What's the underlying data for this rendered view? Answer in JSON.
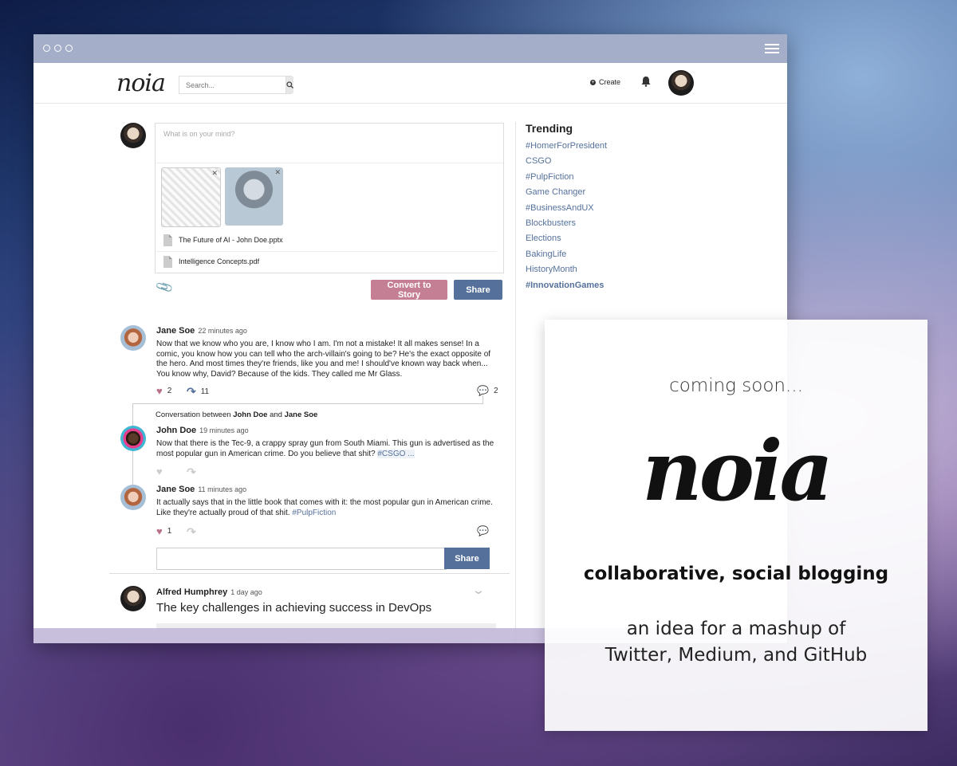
{
  "header": {
    "logo": "noia",
    "search_placeholder": "Search...",
    "create_label": "Create"
  },
  "composer": {
    "placeholder": "What is on your mind?",
    "files": [
      {
        "name": "The Future of AI - John Doe.pptx",
        "type": "PPT"
      },
      {
        "name": "Intelligence Concepts.pdf",
        "type": "PDF"
      }
    ],
    "convert_label": "Convert to Story",
    "share_label": "Share"
  },
  "post1": {
    "author": "Jane Soe",
    "time": "22 minutes ago",
    "text": "Now that we know who you are, I know who I am. I'm not a mistake! It all makes sense! In a comic, you know how you can tell who the arch-villain's going to be? He's the exact opposite of the hero. And most times they're friends, like you and me! I should've known way back when... You know why, David? Because of the kids. They called me Mr Glass.",
    "likes": "2",
    "shares": "11",
    "comments": "2"
  },
  "conversation": {
    "prefix": "Conversation between",
    "person1": "John Doe",
    "and": "and",
    "person2": "Jane Soe"
  },
  "reply1": {
    "author": "John Doe",
    "time": "19 minutes ago",
    "text": "Now that there is the Tec-9, a crappy spray gun from South Miami. This gun is advertised as the most popular gun in American crime. Do you believe that shit?",
    "tag": "#CSGO ..."
  },
  "reply2": {
    "author": "Jane Soe",
    "time": "11 minutes ago",
    "text": "It actually says that in the little book that comes with it: the most popular gun in American crime. Like they're actually proud of that shit.",
    "tag": "#PulpFiction",
    "likes": "1"
  },
  "reply_share_label": "Share",
  "post2": {
    "author": "Alfred Humphrey",
    "time": "1 day ago",
    "headline": "The key challenges in achieving success in DevOps"
  },
  "trending": {
    "title": "Trending",
    "items": [
      "#HomerForPresident",
      "CSGO",
      "#PulpFiction",
      "Game Changer",
      "#BusinessAndUX",
      "Blockbusters",
      "Elections",
      "BakingLife",
      "HistoryMonth",
      "#InnovationGames"
    ]
  },
  "promo": {
    "coming_soon": "coming soon...",
    "logo": "noia",
    "tagline": "collaborative, social blogging",
    "desc_line1": "an idea for a mashup of",
    "desc_line2": "Twitter, Medium, and GitHub"
  }
}
